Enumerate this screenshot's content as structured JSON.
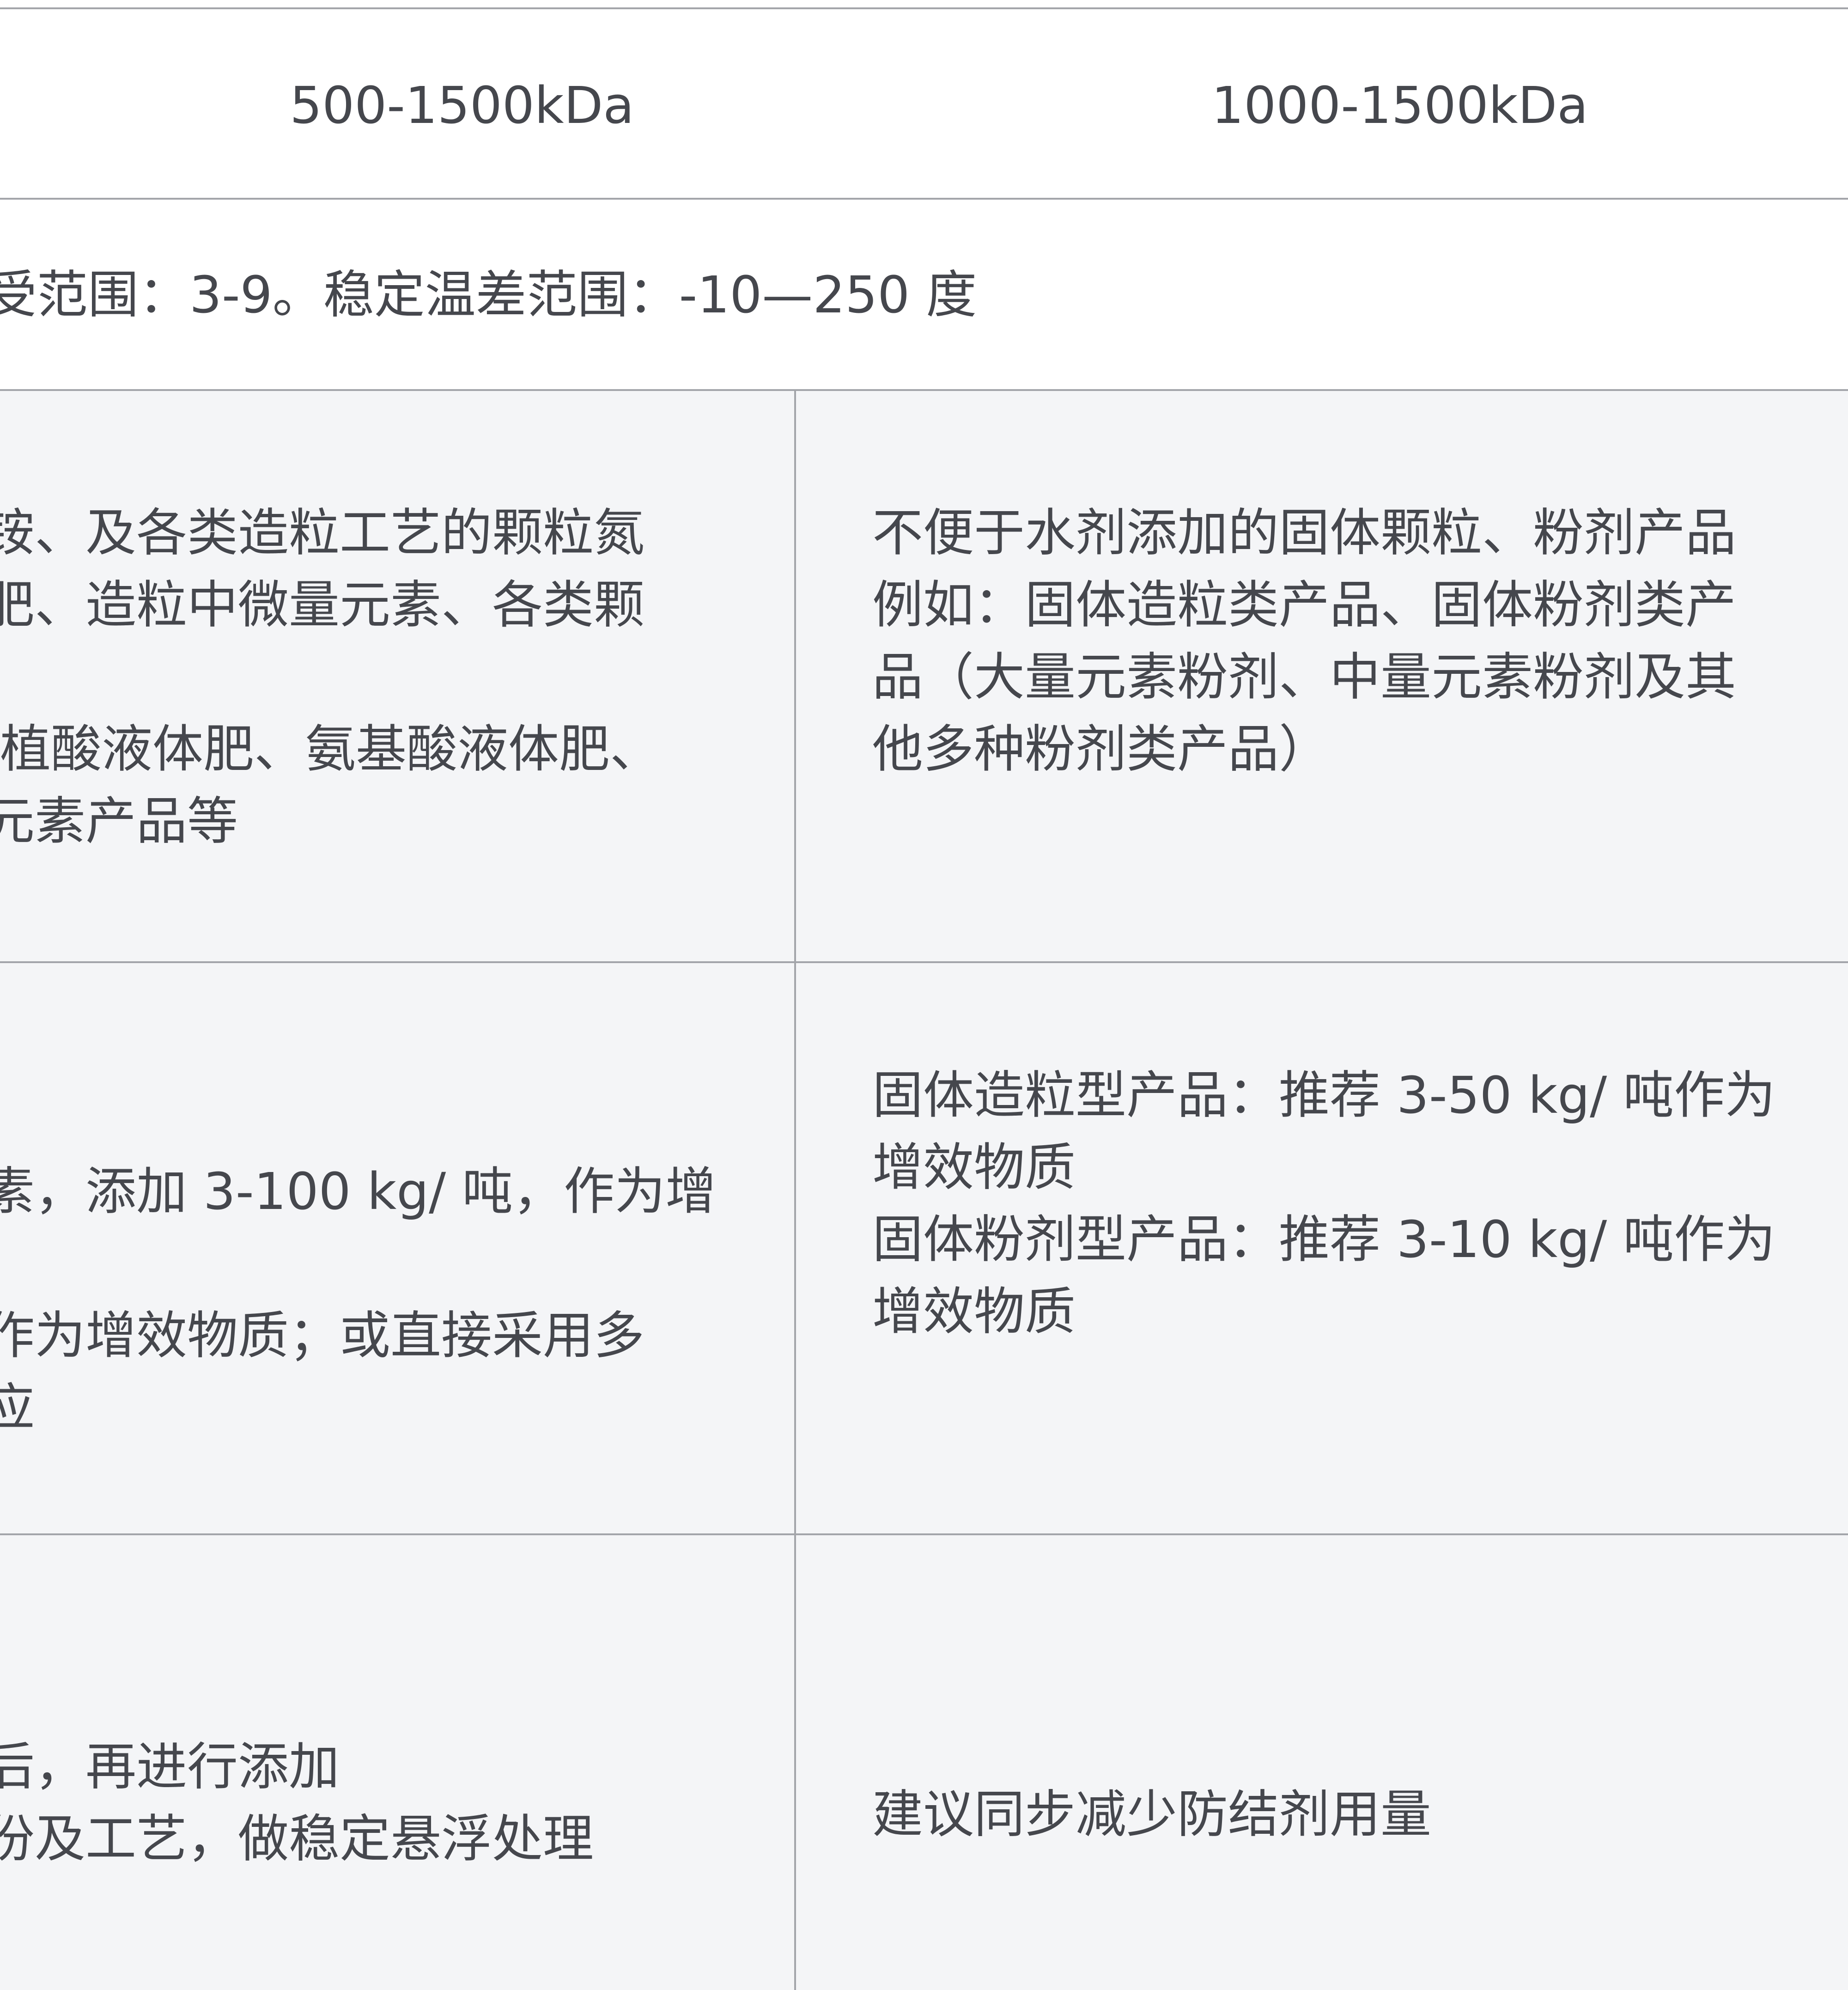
{
  "rows": {
    "molecular_weight": {
      "col2": "500-1500kDa",
      "col3": "1000-1500kDa"
    },
    "stability": {
      "text": "受范围：3-9。稳定温差范围：-10—250 度"
    },
    "application": {
      "col2_lines": [
        "铵、及各类造粒工艺的颗粒氮",
        "肥、造粒中微量元素、各类颗",
        "",
        "植酸液体肥、氨基酸液体肥、",
        "元素产品等"
      ],
      "col3_lines": [
        "不便于水剂添加的固体颗粒、粉剂产品",
        "例如：固体造粒类产品、固体粉剂类产",
        "品（大量元素粉剂、中量元素粉剂及其",
        "他多种粉剂类产品）"
      ]
    },
    "dosage": {
      "col2_lines": [
        "素，添加 3-100 kg/ 吨，作为增",
        "",
        "作为增效物质；或直接采用多",
        "应"
      ],
      "col3_lines": [
        "固体造粒型产品：推荐 3-50 kg/ 吨作为",
        "增效物质",
        "固体粉剂型产品：推荐 3-10 kg/ 吨作为",
        "增效物质"
      ]
    },
    "notes": {
      "col2_lines": [
        "后，再进行添加",
        "份及工艺，做稳定悬浮处理"
      ],
      "col3_lines": [
        "建议同步减少防结剂用量"
      ]
    }
  },
  "colors": {
    "text": "#45474d",
    "border": "#a3a5aa",
    "row_grey": "#f4f5f7",
    "row_white": "#ffffff"
  }
}
